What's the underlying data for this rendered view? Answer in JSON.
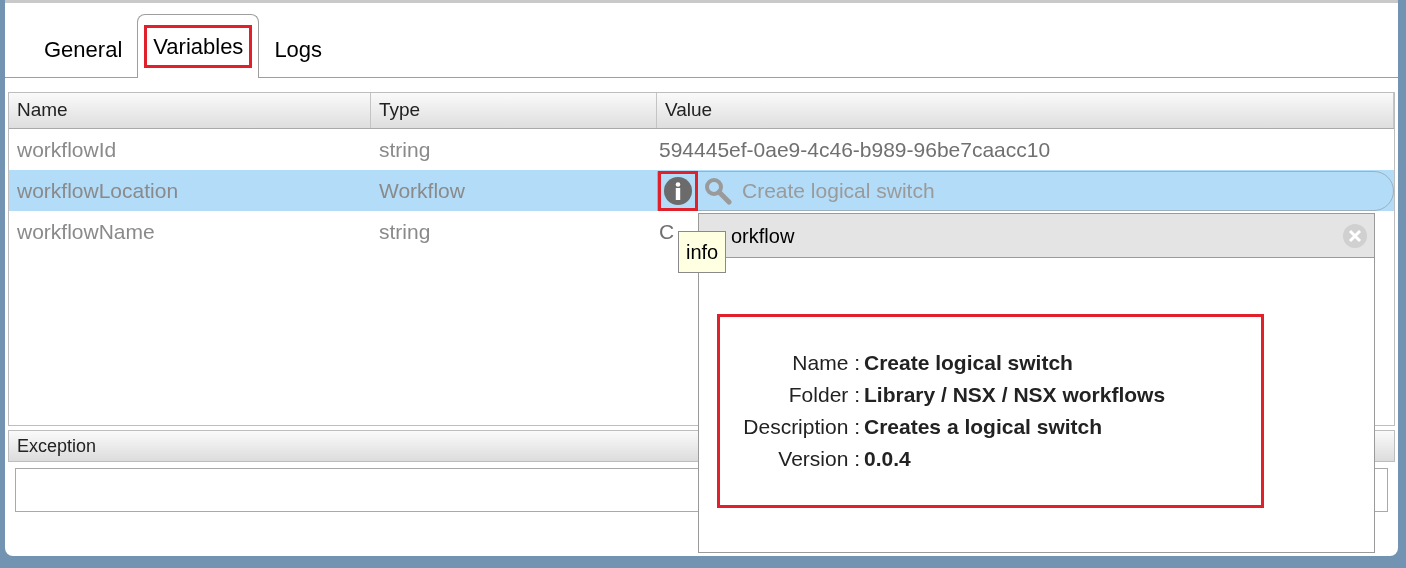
{
  "tabs": [
    {
      "label": "General",
      "selected": false,
      "highlighted": false
    },
    {
      "label": "Variables",
      "selected": true,
      "highlighted": true
    },
    {
      "label": "Logs",
      "selected": false,
      "highlighted": false
    }
  ],
  "table": {
    "columns": [
      "Name",
      "Type",
      "Value"
    ],
    "rows": [
      {
        "name": "workflowId",
        "type": "string",
        "value": "594445ef-0ae9-4c46-b989-96be7caacc10",
        "selected": false,
        "kind": "text"
      },
      {
        "name": "workflowLocation",
        "type": "Workflow",
        "value": "Create logical switch",
        "selected": true,
        "kind": "reference"
      },
      {
        "name": "workflowName",
        "type": "string",
        "value": "C",
        "selected": false,
        "kind": "text"
      }
    ]
  },
  "exception": {
    "label": "Exception"
  },
  "tooltip": {
    "text": "info"
  },
  "popup": {
    "title": "orkflow",
    "fields": [
      {
        "label": "Name :",
        "value": "Create logical switch"
      },
      {
        "label": "Folder :",
        "value": "Library / NSX / NSX workflows"
      },
      {
        "label": "Description :",
        "value": "Creates a logical switch"
      },
      {
        "label": "Version :",
        "value": "0.0.4"
      }
    ]
  }
}
